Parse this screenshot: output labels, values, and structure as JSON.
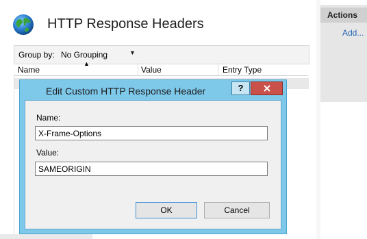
{
  "header": {
    "title": "HTTP Response Headers",
    "icon": "globe-icon"
  },
  "toolbar": {
    "group_by_label": "Group by:",
    "group_by_value": "No Grouping"
  },
  "columns": [
    "Name",
    "Value",
    "Entry Type"
  ],
  "actions": {
    "title": "Actions",
    "add_label": "Add..."
  },
  "dialog": {
    "title": "Edit Custom HTTP Response Header",
    "help_label": "?",
    "name_label": "Name:",
    "name_value": "X-Frame-Options",
    "value_label": "Value:",
    "value_value": "SAMEORIGIN",
    "ok_label": "OK",
    "cancel_label": "Cancel"
  },
  "colors": {
    "accent": "#7ec8ea",
    "close": "#c9514a",
    "link": "#1f5fb4"
  }
}
